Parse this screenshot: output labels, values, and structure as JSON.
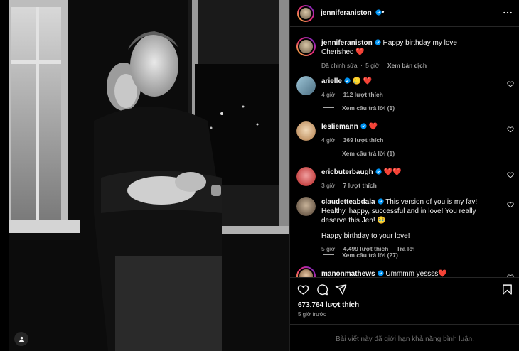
{
  "post": {
    "author": "jenniferaniston",
    "header_dot": "•",
    "caption_line1": "Happy birthday my love",
    "caption_line2": "Cherished ❤️",
    "caption_edited": "Đã chỉnh sửa",
    "caption_sep": "·",
    "caption_time": "5 giờ",
    "caption_translate": "Xem bản dịch"
  },
  "comments": [
    {
      "username": "arielle",
      "text": "🥲 ❤️",
      "time": "4 giờ",
      "likes": "112 lượt thích",
      "replies": "Xem câu trả lời (1)"
    },
    {
      "username": "lesliemann",
      "text": "❤️",
      "time": "4 giờ",
      "likes": "369 lượt thích",
      "replies": "Xem câu trả lời (1)"
    },
    {
      "username": "ericbuterbaugh",
      "text": "❤️❤️",
      "time": "3 giờ",
      "likes": "7 lượt thích",
      "replies": ""
    },
    {
      "username": "claudetteabdala",
      "text": "This version of you is my fav! Healthy, happy, successful and in love! You really deserve this Jen! 🥹",
      "text2": "Happy birthday to your love!",
      "time": "5 giờ",
      "likes": "4.499 lượt thích",
      "reply_label": "Trả lời",
      "replies": "Xem câu trả lời (27)"
    },
    {
      "username": "manonmathews",
      "text": "Ummmm yessss❤️"
    }
  ],
  "footer": {
    "like_count": "673.764 lượt thích",
    "posted_ago": "5 giờ trước",
    "comments_limited": "Bài viết này đã giới hạn khả năng bình luận."
  },
  "icons": {
    "more": "more-horizontal-icon",
    "heart": "heart-icon",
    "comment": "comment-icon",
    "share": "share-icon",
    "save": "bookmark-icon",
    "verified": "verified-badge-icon",
    "tag_user": "user-tag-icon"
  },
  "colors": {
    "verified": "#0095f6",
    "heart_red": "#ff3040",
    "secondary_text": "#a8a8a8"
  }
}
